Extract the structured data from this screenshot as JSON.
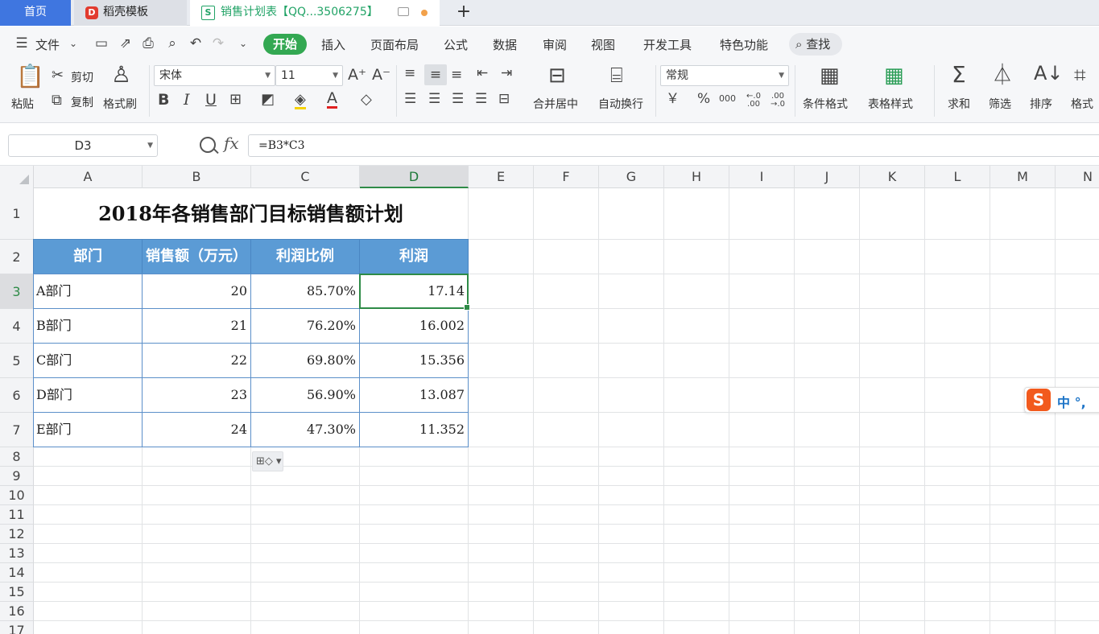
{
  "tabs": {
    "home": "首页",
    "template": "稻壳模板",
    "doc": "销售计划表【QQ...3506275】",
    "template_icon": "D",
    "doc_icon": "S"
  },
  "menu": {
    "file": "文件",
    "start": "开始",
    "insert": "插入",
    "layout": "页面布局",
    "formula": "公式",
    "data": "数据",
    "review": "审阅",
    "view": "视图",
    "dev": "开发工具",
    "special": "特色功能",
    "search": "查找"
  },
  "ribbon": {
    "paste": "粘贴",
    "cut": "剪切",
    "copy": "复制",
    "format_painter": "格式刷",
    "font": "宋体",
    "size": "11",
    "merge": "合并居中",
    "wrap": "自动换行",
    "number_format": "常规",
    "currency": "￥",
    "percent": "%",
    "thousands": "000",
    "inc_dec": "←.0 .00",
    "dec_dec": ".00 →.0",
    "cond_format": "条件格式",
    "table_style": "表格样式",
    "sum": "求和",
    "filter": "筛选",
    "sort": "排序",
    "format": "格式"
  },
  "formula_bar": {
    "name_box": "D3",
    "fx": "fx",
    "formula": "=B3*C3"
  },
  "columns": [
    "A",
    "B",
    "C",
    "D",
    "E",
    "F",
    "G",
    "H",
    "I",
    "J",
    "K",
    "L",
    "M",
    "N"
  ],
  "rows": [
    "1",
    "2",
    "3",
    "4",
    "5",
    "6",
    "7",
    "8",
    "9",
    "10",
    "11",
    "12",
    "13",
    "14",
    "15",
    "16",
    "17"
  ],
  "sheet": {
    "title": "2018年各销售部门目标销售额计划",
    "headers": [
      "部门",
      "销售额（万元）",
      "利润比例",
      "利润"
    ],
    "data": [
      [
        "A部门",
        "20",
        "85.70%",
        "17.14"
      ],
      [
        "B部门",
        "21",
        "76.20%",
        "16.002"
      ],
      [
        "C部门",
        "22",
        "69.80%",
        "15.356"
      ],
      [
        "D部门",
        "23",
        "56.90%",
        "13.087"
      ],
      [
        "E部门",
        "24",
        "47.30%",
        "11.352"
      ]
    ]
  },
  "ime": {
    "badge": "S",
    "mode": "中 °,"
  },
  "colors": {
    "accent": "#33a852",
    "header_fill": "#5b9bd5",
    "selection": "#2e8b47",
    "home_tab": "#3f76e0"
  }
}
